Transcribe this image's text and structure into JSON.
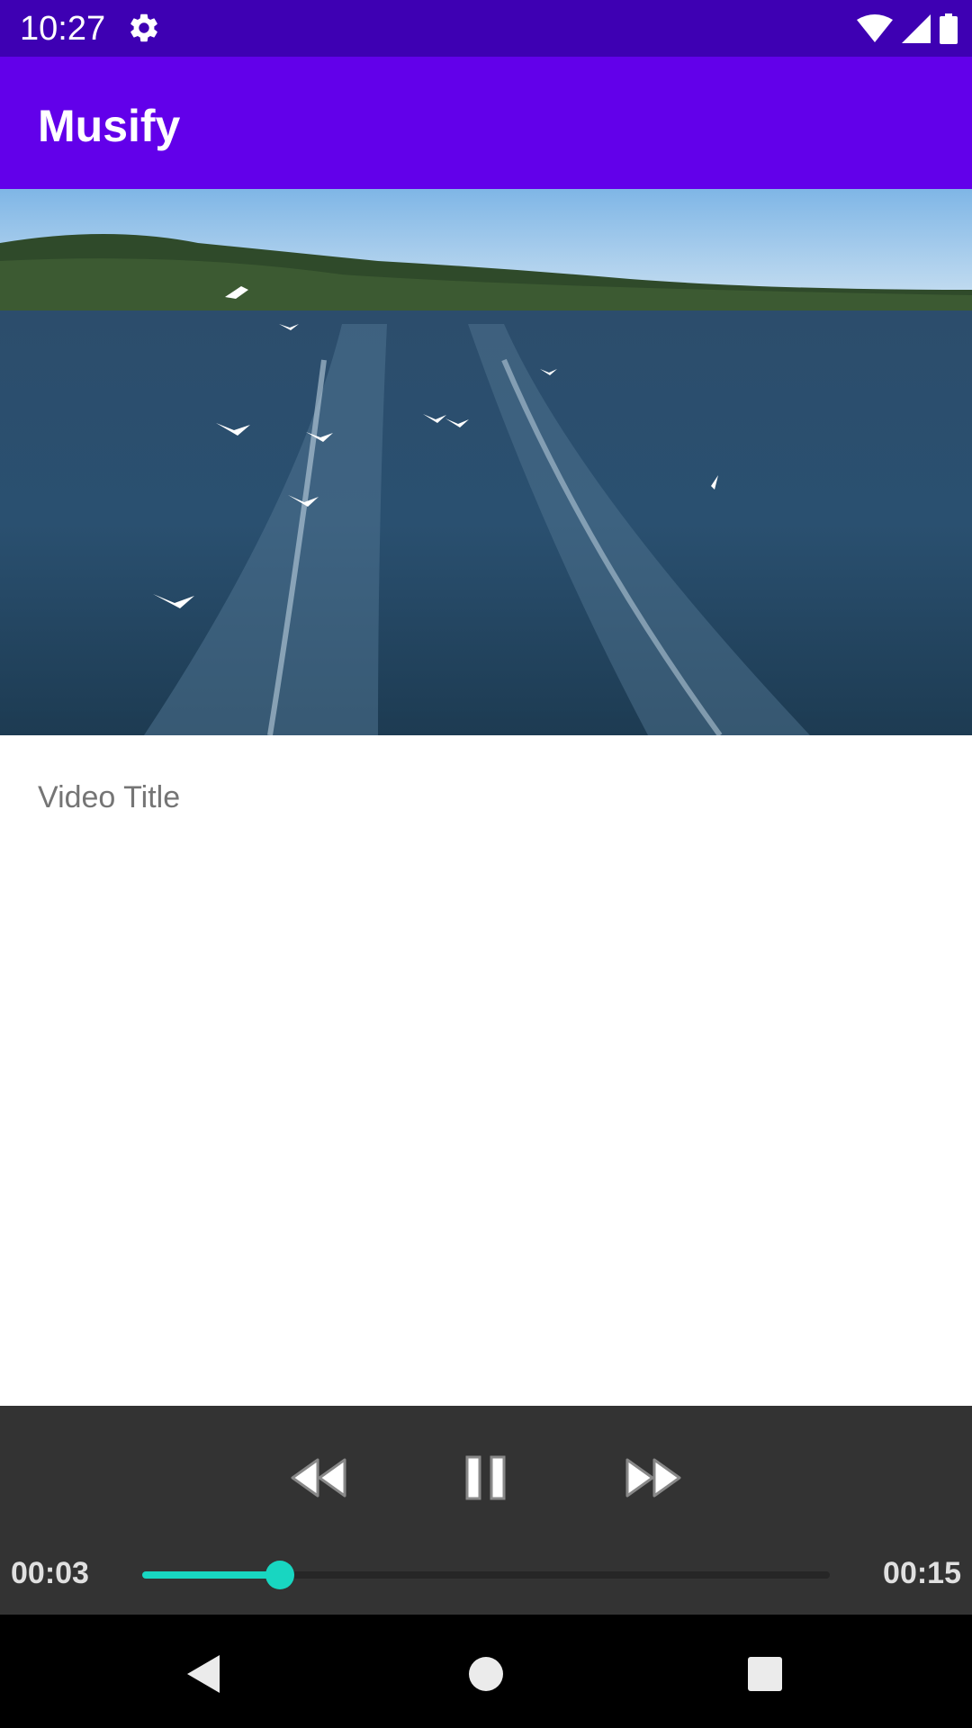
{
  "status_bar": {
    "time": "10:27",
    "icons": [
      "gear-icon",
      "wifi-icon",
      "signal-icon",
      "battery-icon"
    ],
    "color": "#3e00b3"
  },
  "app_bar": {
    "title": "Musify",
    "color": "#6200ea"
  },
  "video": {
    "title": "Video Title"
  },
  "player": {
    "position": "00:03",
    "duration": "00:15",
    "progress": 0.2,
    "buttons": [
      "rewind-icon",
      "pause-icon",
      "fast-forward-icon"
    ],
    "accent_color": "#18d6c1",
    "background_color": "#333333"
  },
  "nav_bar": {
    "buttons": [
      "back-icon",
      "home-icon",
      "recents-icon"
    ]
  }
}
